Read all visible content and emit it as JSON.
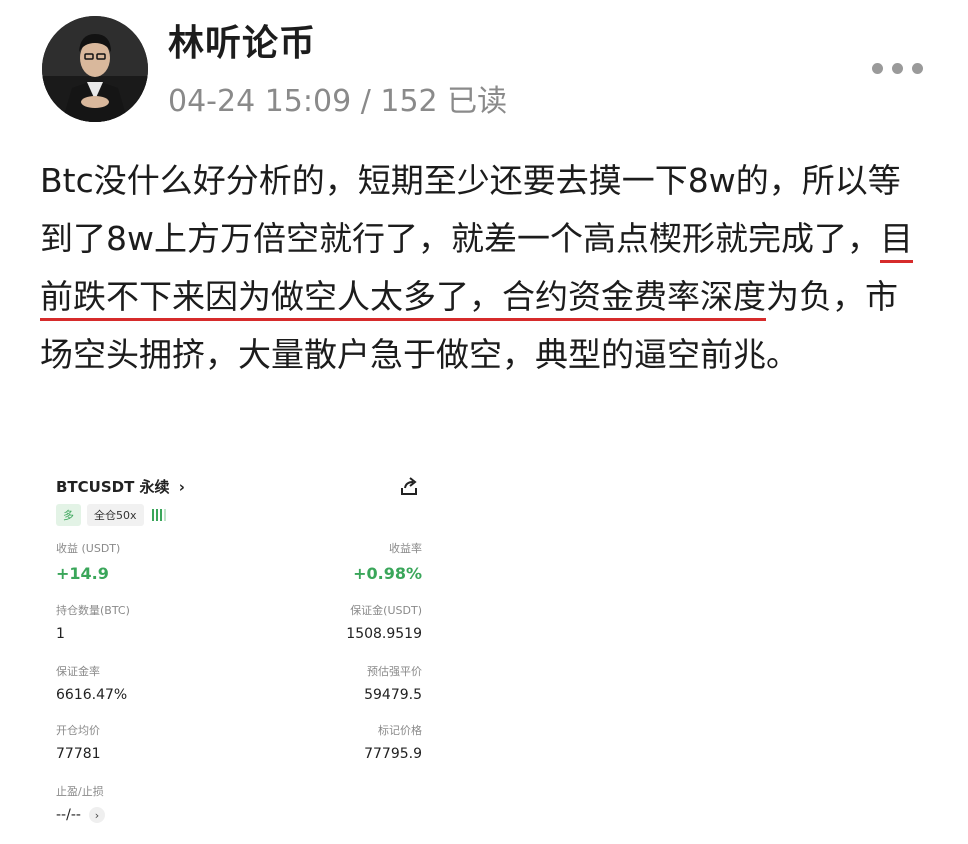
{
  "author": {
    "name": "林听论币"
  },
  "post_meta": {
    "datetime": "04-24 15:09",
    "separator": " / ",
    "reads": "152 已读"
  },
  "post": {
    "text_before": "Btc没什么好分析的，短期至少还要去摸一下8w的，所以等到了8w上方万倍空就行了，就差一个高点楔形就完成了，",
    "highlight": "目前跌不下来因为做空人太多了，合约资金费率深度",
    "text_after": "为负，市场空头拥挤，大量散户急于做空，典型的逼空前兆。"
  },
  "position_card": {
    "symbol": "BTCUSDT 永续",
    "chevron": "›",
    "side_tag": "多",
    "margin_tag": "全仓50x",
    "pnl_label": "收益 (USDT)",
    "pnl_value": "+14.9",
    "roi_label": "收益率",
    "roi_value": "+0.98%",
    "size_label": "持仓数量(BTC)",
    "size_value": "1",
    "margin_label": "保证金(USDT)",
    "margin_value": "1508.9519",
    "margin_ratio_label": "保证金率",
    "margin_ratio_value": "6616.47%",
    "liq_label": "预估强平价",
    "liq_value": "59479.5",
    "entry_label": "开仓均价",
    "entry_value": "77781",
    "mark_label": "标记价格",
    "mark_value": "77795.9",
    "tpsl_label": "止盈/止损",
    "tpsl_value": "--/--"
  },
  "colors": {
    "profit": "#3aa65a",
    "underline": "#d62b2b",
    "meta": "#8a8a8a"
  },
  "icons": [
    "avatar-portrait",
    "more-dots-icon",
    "share-icon",
    "chevron-right-icon",
    "leverage-bars-icon"
  ]
}
